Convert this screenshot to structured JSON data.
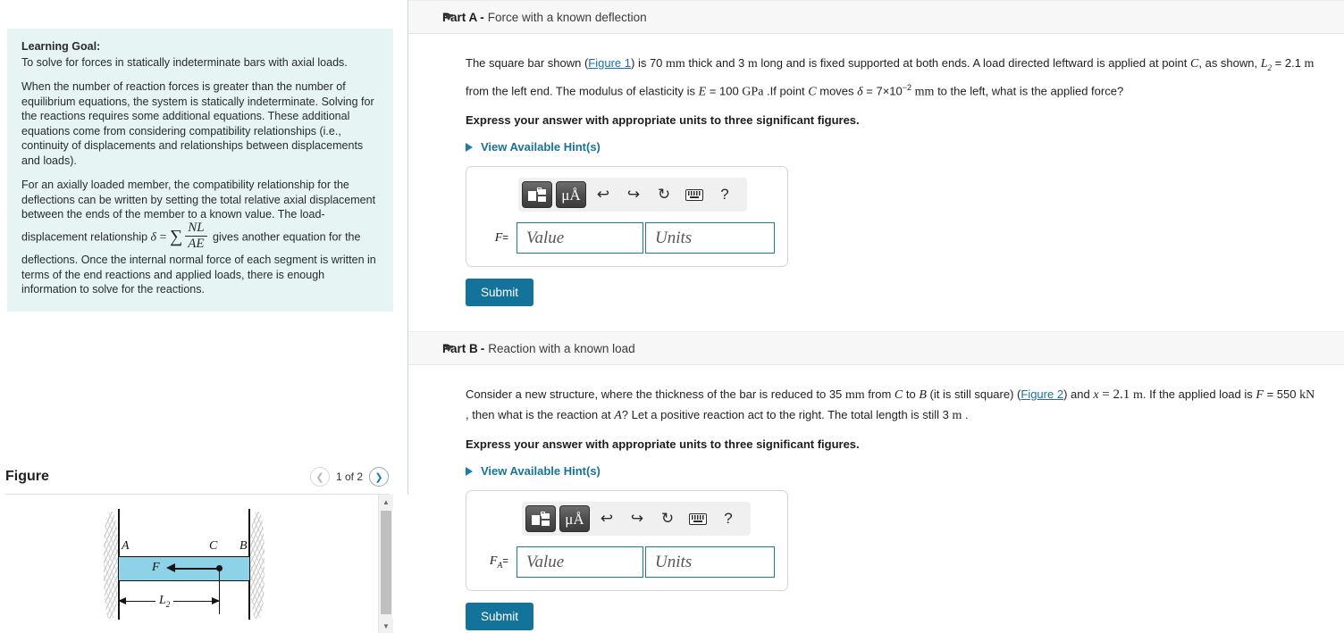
{
  "left": {
    "learning_goal": {
      "title": "Learning Goal:",
      "p1": "To solve for forces in statically indeterminate bars with axial loads.",
      "p2": "When the number of reaction forces is greater than the number of equilibrium equations, the system is statically indeterminate. Solving for the reactions requires some additional equations. These additional equations come from considering compatibility relationships (i.e., continuity of displacements and relationships between displacements and loads).",
      "p3_a": "For an axially loaded member, the compatibility relationship for the deflections can be written by setting the total relative axial displacement between the ends of the member to a known value. The load-displacement relationship",
      "delta": "δ",
      "equals": "=",
      "sum": "∑",
      "frac_num": "NL",
      "frac_den": "AE",
      "p3_b": "gives another equation for the deflections. Once the internal normal force of each segment is written in terms of the end reactions and applied loads, there is enough information to solve for the reactions."
    },
    "figure": {
      "title": "Figure",
      "prev_icon": "chevron-left-icon",
      "next_icon": "chevron-right-icon",
      "counter": "1 of 2",
      "diagram": {
        "label_a": "A",
        "label_c": "C",
        "label_b": "B",
        "label_f": "F",
        "label_l2": "L",
        "label_l2_sub": "2",
        "bar_color": "#8ed2e8"
      },
      "scrollbar": {
        "up_icon": "triangle-up-icon",
        "down_icon": "triangle-down-icon"
      }
    }
  },
  "parts": [
    {
      "id": "part-a",
      "caret_icon": "caret-down-icon",
      "label": "Part A",
      "dash": "-",
      "subtitle": "Force with a known deflection",
      "question_segments": [
        {
          "t": "text",
          "v": "The square bar shown ("
        },
        {
          "t": "link",
          "v": "Figure 1"
        },
        {
          "t": "text",
          "v": ") is 70 "
        },
        {
          "t": "mathup",
          "v": "mm"
        },
        {
          "t": "text",
          "v": " thick and 3 "
        },
        {
          "t": "mathup",
          "v": "m"
        },
        {
          "t": "text",
          "v": " long and is fixed supported at both ends. A load directed leftward is applied at point "
        },
        {
          "t": "mathit",
          "v": "C"
        },
        {
          "t": "text",
          "v": ", as shown, "
        },
        {
          "t": "mathsub",
          "v": "L",
          "sub": "2"
        },
        {
          "t": "text",
          "v": " = 2.1 "
        },
        {
          "t": "mathup",
          "v": "m"
        },
        {
          "t": "text",
          "v": " from the left end. The modulus of elasticity is "
        },
        {
          "t": "mathit",
          "v": "E"
        },
        {
          "t": "text",
          "v": " = 100 "
        },
        {
          "t": "mathup",
          "v": "GPa"
        },
        {
          "t": "text",
          "v": " .If point "
        },
        {
          "t": "mathit",
          "v": "C"
        },
        {
          "t": "text",
          "v": " moves "
        },
        {
          "t": "mathit",
          "v": "δ"
        },
        {
          "t": "text",
          "v": " = 7×10"
        },
        {
          "t": "sup",
          "v": "−2"
        },
        {
          "t": "text",
          "v": " "
        },
        {
          "t": "mathup",
          "v": "mm"
        },
        {
          "t": "text",
          "v": " to the left, what is the applied force?"
        }
      ],
      "instruction": "Express your answer with appropriate units to three significant figures.",
      "hints_label": "View Available Hint(s)",
      "hint_caret_icon": "caret-right-icon",
      "toolbar": {
        "template_button": "math-template-icon",
        "units_button": "μÅ",
        "undo_button": "undo-icon",
        "redo_button": "redo-icon",
        "reset_button": "reset-icon",
        "keyboard_button": "keyboard-icon",
        "help_button": "?"
      },
      "answer": {
        "var_label": "F",
        "var_sub": "",
        "equals": "=",
        "value_placeholder": "Value",
        "units_placeholder": "Units",
        "value": "",
        "units": ""
      },
      "submit_label": "Submit"
    },
    {
      "id": "part-b",
      "caret_icon": "caret-down-icon",
      "label": "Part B",
      "dash": "-",
      "subtitle": "Reaction with a known load",
      "question_segments": [
        {
          "t": "text",
          "v": "Consider a new structure, where the thickness of the bar is reduced to 35 "
        },
        {
          "t": "mathup",
          "v": "mm"
        },
        {
          "t": "text",
          "v": " from "
        },
        {
          "t": "mathit",
          "v": "C"
        },
        {
          "t": "text",
          "v": " to "
        },
        {
          "t": "mathit",
          "v": "B"
        },
        {
          "t": "text",
          "v": " (it is still square) ("
        },
        {
          "t": "link",
          "v": "Figure 2"
        },
        {
          "t": "text",
          "v": ") and "
        },
        {
          "t": "mathit",
          "v": "x"
        },
        {
          "t": "mathbig",
          "v": " = 2.1 "
        },
        {
          "t": "mathup",
          "v": "m"
        },
        {
          "t": "text",
          "v": ". If the applied load is "
        },
        {
          "t": "mathit",
          "v": "F"
        },
        {
          "t": "text",
          "v": " = 550 "
        },
        {
          "t": "mathup",
          "v": "kN"
        },
        {
          "t": "text",
          "v": " , then what is the reaction at "
        },
        {
          "t": "mathit",
          "v": "A"
        },
        {
          "t": "text",
          "v": "? Let a positive reaction act to the right. The total length is still 3 "
        },
        {
          "t": "mathup",
          "v": "m"
        },
        {
          "t": "text",
          "v": " ."
        }
      ],
      "instruction": "Express your answer with appropriate units to three significant figures.",
      "hints_label": "View Available Hint(s)",
      "hint_caret_icon": "caret-right-icon",
      "toolbar": {
        "template_button": "math-template-icon",
        "units_button": "μÅ",
        "undo_button": "undo-icon",
        "redo_button": "redo-icon",
        "reset_button": "reset-icon",
        "keyboard_button": "keyboard-icon",
        "help_button": "?"
      },
      "answer": {
        "var_label": "F",
        "var_sub": "A",
        "equals": "=",
        "value_placeholder": "Value",
        "units_placeholder": "Units",
        "value": "",
        "units": ""
      },
      "submit_label": "Submit"
    }
  ],
  "colors": {
    "accent": "#14739a",
    "link": "#1a6fa8",
    "goal_bg": "#e6f4f4",
    "bar_fill": "#8ed2e8",
    "header_bg": "#f7f7f7"
  }
}
